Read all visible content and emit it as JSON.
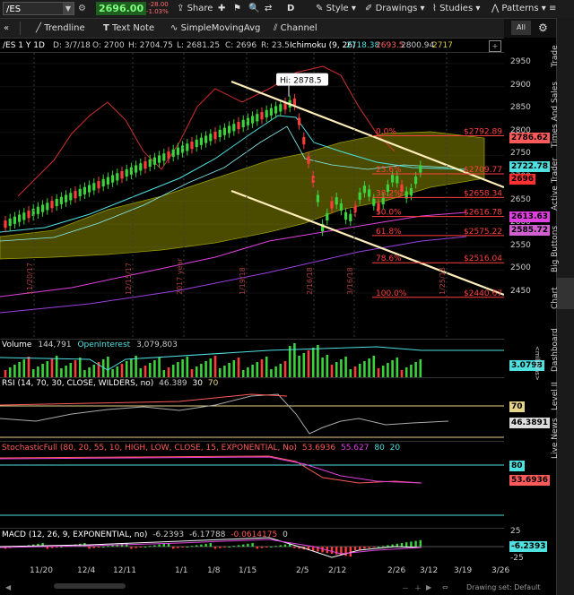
{
  "topbar": {
    "symbol": "/ES",
    "last_price": "2696.00",
    "change": "-28.00",
    "change_pct": "-1.03%",
    "share_label": "Share",
    "style_label": "Style",
    "drawings_label": "Drawings",
    "studies_label": "Studies",
    "patterns_label": "Patterns",
    "d_label": "D",
    "all_label": "All"
  },
  "tools": {
    "trendline": "Trendline",
    "textnote": "Text Note",
    "sma": "SimpleMovingAvg",
    "channel": "Channel"
  },
  "info": {
    "title": "/ES 1 Y 1D",
    "date": "D: 3/7/18",
    "open": "O: 2700",
    "high": "H: 2704.75",
    "low": "L: 2681.25",
    "close": "C: 2696",
    "range": "R: 23.5",
    "ichimoku": "Ichimoku (9, 26)",
    "v1": "2718.38",
    "v2": "2693.5",
    "v3": "2800.94",
    "v4": "2717"
  },
  "price_pane": {
    "y_ticks": [
      "2950",
      "2900",
      "2850",
      "2800",
      "2750",
      "2700",
      "2650",
      "2600",
      "2550",
      "2500",
      "2450"
    ],
    "hi_label": "Hi: 2878.5",
    "fib": [
      {
        "pct": "0.0%",
        "value": "$2792.89"
      },
      {
        "pct": "23.6%",
        "value": "$2709.77"
      },
      {
        "pct": "38.2%",
        "value": "$2658.34"
      },
      {
        "pct": "50.0%",
        "value": "$2616.78"
      },
      {
        "pct": "61.8%",
        "value": "$2575.22"
      },
      {
        "pct": "78.6%",
        "value": "$2516.04"
      },
      {
        "pct": "100.0%",
        "value": "$2440.67"
      }
    ],
    "badges": [
      {
        "text": "2786.62",
        "color": "#ff5a5a"
      },
      {
        "text": "2722.78",
        "color": "#4fe0e0"
      },
      {
        "text": "2696",
        "color": "#ff3030"
      },
      {
        "text": "2613.63",
        "color": "#e040e0"
      },
      {
        "text": "2585.72",
        "color": "#d060d0"
      }
    ],
    "date_markers": [
      "11/20/17",
      "12/15/17",
      "2017 year",
      "1/19/18",
      "2/16/18",
      "3/16/18",
      "1/25/18"
    ]
  },
  "volume_pane": {
    "label": "Volume",
    "volume": "144,791",
    "oi_label": "OpenInterest",
    "oi": "3,079,803",
    "badge": "3.0798",
    "units": "<millions>"
  },
  "rsi_pane": {
    "label": "RSI (14, 70, 30, CLOSE, WILDERS, no)",
    "value": "46.389",
    "l30": "30",
    "l70": "70",
    "badge70": "70",
    "badge": "46.3891"
  },
  "stoch_pane": {
    "label": "StochasticFull (80, 20, 55, 10, HIGH, LOW, CLOSE, 15, EXPONENTIAL, No)",
    "v1": "53.6936",
    "v2": "55.627",
    "v3": "80",
    "v4": "20",
    "badge80": "80",
    "badge": "53.6936"
  },
  "macd_pane": {
    "label": "MACD (12, 26, 9, EXPONENTIAL, no)",
    "v1": "-6.2393",
    "v2": "-6.17788",
    "v3": "-0.0614175",
    "v4": "0",
    "y_ticks": [
      "25",
      "0",
      "-25"
    ],
    "badge": "-6.2393"
  },
  "x_axis": [
    "11/20",
    "12/4",
    "12/11",
    "1/1",
    "1/8",
    "1/15",
    "2/5",
    "2/12",
    "2/26",
    "3/12",
    "3/19",
    "3/26"
  ],
  "right_tabs": [
    "Trade",
    "Times And Sales",
    "Active Trader",
    "Big Buttons",
    "Chart",
    "Dashboard",
    "Level II",
    "Live News"
  ],
  "footer": "Drawing set: Default",
  "colors": {
    "up": "#3cd23c",
    "down": "#ff3c3c",
    "fib": "#ff4040",
    "channel": "#ffeebb",
    "cloud": "#8a8a00"
  }
}
